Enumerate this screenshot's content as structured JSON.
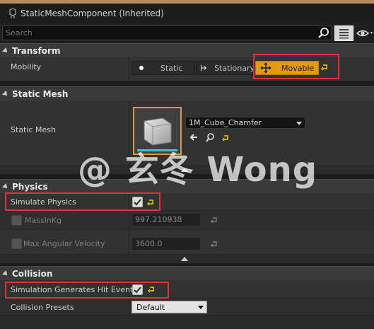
{
  "component": {
    "title": "StaticMeshComponent (Inherited)",
    "icon": "component-icon"
  },
  "search": {
    "placeholder": "Search"
  },
  "transform": {
    "header": "Transform",
    "mobility_label": "Mobility",
    "options": [
      "Static",
      "Stationary",
      "Movable"
    ],
    "selected": "Movable"
  },
  "static_mesh": {
    "header": "Static Mesh",
    "label": "Static Mesh",
    "asset": "1M_Cube_Chamfer"
  },
  "physics": {
    "header": "Physics",
    "simulate_label": "Simulate Physics",
    "simulate_checked": true,
    "mass_label": "MassInKg",
    "mass_value": "997.210938",
    "max_ang_label": "Max Angular Velocity",
    "max_ang_value": "3600.0"
  },
  "collision": {
    "header": "Collision",
    "hit_events_label": "Simulation Generates Hit Events",
    "hit_events_checked": true,
    "presets_label": "Collision Presets",
    "presets_value": "Default"
  },
  "watermark": "@ 玄冬 Wong",
  "colors": {
    "movable_accent": "#e39b0d",
    "highlight_box": "#e0303a",
    "reset_arrow": "#f2d600"
  }
}
